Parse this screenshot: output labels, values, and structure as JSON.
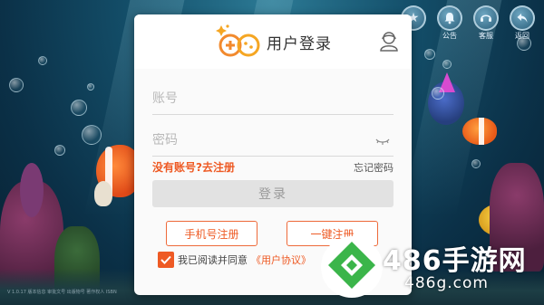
{
  "dialog": {
    "title": "用户登录",
    "account_placeholder": "账号",
    "password_placeholder": "密码",
    "register_link": "没有账号?去注册",
    "forgot_link": "忘记密码",
    "login_button": "登录",
    "phone_register_button": "手机号注册",
    "onekey_register_button": "一键注册",
    "agree_text": "我已阅读并同意",
    "agreement_link": "《用户协议》",
    "agree_checked": true
  },
  "top_icons": [
    {
      "icon": "star-icon",
      "label": ""
    },
    {
      "icon": "bell-icon",
      "label": "公告"
    },
    {
      "icon": "service-icon",
      "label": "客服"
    },
    {
      "icon": "back-icon",
      "label": "返回"
    }
  ],
  "watermark": {
    "main": "486手游网",
    "sub": "486g.com"
  },
  "colors": {
    "accent": "#ee5a24",
    "login_disabled": "#e2e2e2",
    "watermark_green": "#3bb54a"
  }
}
